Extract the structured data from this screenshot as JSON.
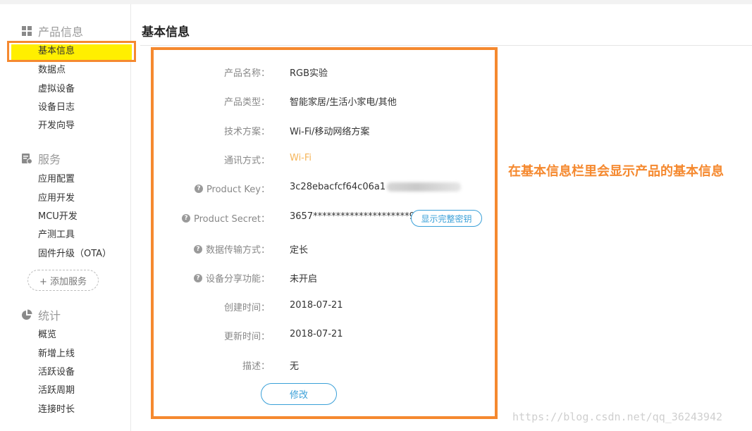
{
  "sidebar": {
    "product": {
      "header": "产品信息",
      "icon": "grid-icon",
      "items": [
        "基本信息",
        "数据点",
        "虚拟设备",
        "设备日志",
        "开发向导"
      ]
    },
    "services": {
      "header": "服务",
      "icon": "service-icon",
      "items": [
        "应用配置",
        "应用开发",
        "MCU开发",
        "产测工具",
        "固件升级（OTA）"
      ],
      "add_button": "+ 添加服务"
    },
    "stats": {
      "header": "统计",
      "icon": "pie-chart-icon",
      "items": [
        "概览",
        "新增上线",
        "活跃设备",
        "活跃周期",
        "连接时长"
      ]
    }
  },
  "main": {
    "title": "基本信息",
    "fields": [
      {
        "label": "产品名称：",
        "value": "RGB实验"
      },
      {
        "label": "产品类型：",
        "value": "智能家居/生活小家电/其他"
      },
      {
        "label": "技术方案：",
        "value": "Wi-Fi/移动网络方案"
      },
      {
        "label": "通讯方式：",
        "value": "Wi-Fi"
      },
      {
        "label": "Product Key：",
        "value": "3c28ebacfcf64c06a1"
      },
      {
        "label": "Product Secret：",
        "value": "3657*********************9025"
      },
      {
        "label": "数据传输方式：",
        "value": "定长"
      },
      {
        "label": "设备分享功能：",
        "value": "未开启"
      },
      {
        "label": "创建时间：",
        "value": "2018-07-21"
      },
      {
        "label": "更新时间：",
        "value": "2018-07-21"
      },
      {
        "label": "描述：",
        "value": "无"
      }
    ],
    "show_secret_button": "显示完整密钥",
    "edit_button": "修改",
    "help_icon": "question-circle-icon"
  },
  "annotation": "在基本信息栏里会显示产品的基本信息",
  "watermark": "https://blog.csdn.net/qq_36243942",
  "colors": {
    "highlight_border": "#f5892f",
    "highlight_fill": "#ffef00",
    "link_blue": "#3aa0d8",
    "wifi_text": "#f5b55a"
  }
}
